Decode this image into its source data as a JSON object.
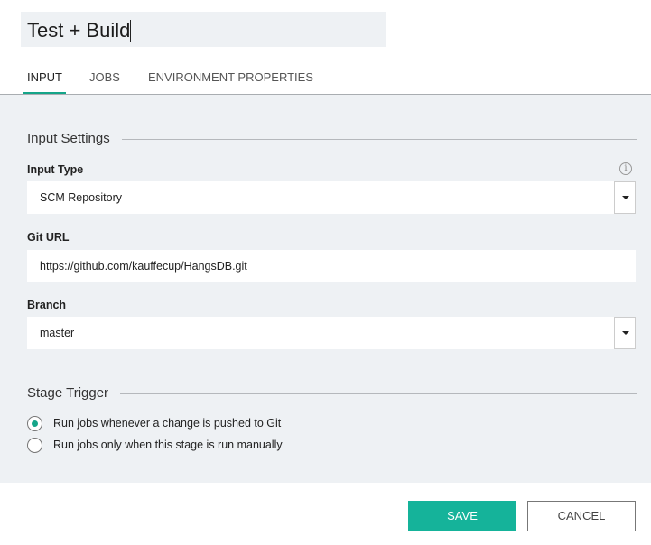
{
  "title": "Test + Build",
  "tabs": [
    {
      "label": "INPUT"
    },
    {
      "label": "JOBS"
    },
    {
      "label": "ENVIRONMENT PROPERTIES"
    }
  ],
  "input_settings": {
    "heading": "Input Settings",
    "input_type": {
      "label": "Input Type",
      "value": "SCM Repository"
    },
    "git_url": {
      "label": "Git URL",
      "value": "https://github.com/kauffecup/HangsDB.git"
    },
    "branch": {
      "label": "Branch",
      "value": "master"
    }
  },
  "stage_trigger": {
    "heading": "Stage Trigger",
    "options": [
      {
        "label": "Run jobs whenever a change is pushed to Git",
        "selected": true
      },
      {
        "label": "Run jobs only when this stage is run manually",
        "selected": false
      }
    ]
  },
  "buttons": {
    "save": "SAVE",
    "cancel": "CANCEL"
  },
  "colors": {
    "accent": "#15a589",
    "panel": "#eef1f4"
  }
}
